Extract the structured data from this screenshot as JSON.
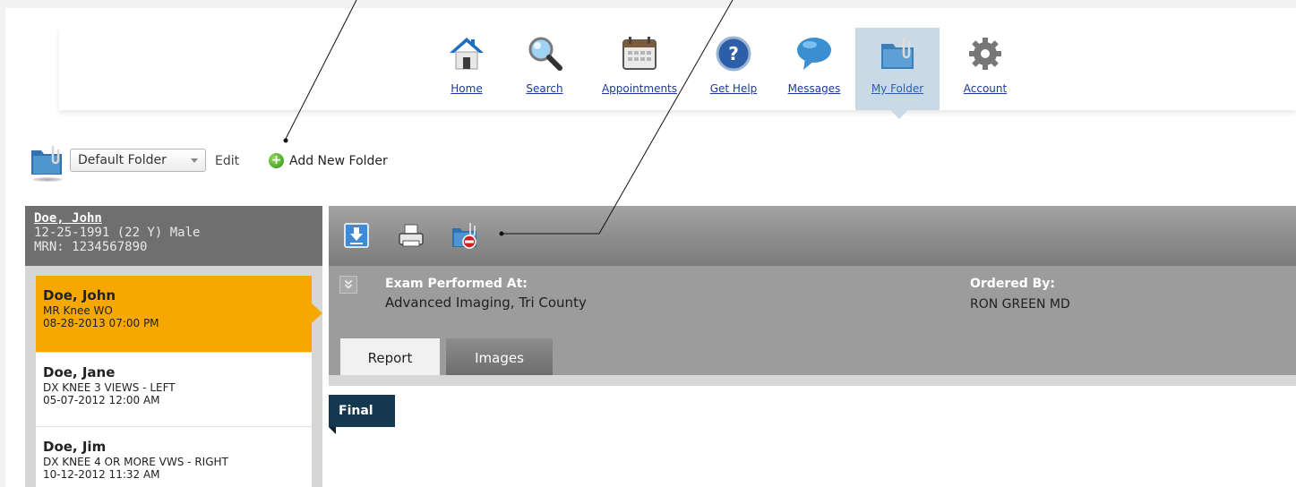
{
  "nav": {
    "items": [
      {
        "label": "Home",
        "icon": "home-icon"
      },
      {
        "label": "Search",
        "icon": "search-icon"
      },
      {
        "label": "Appointments",
        "icon": "calendar-icon"
      },
      {
        "label": "Get Help",
        "icon": "help-icon"
      },
      {
        "label": "Messages",
        "icon": "chat-bubble-icon"
      },
      {
        "label": "My Folder",
        "icon": "folder-clip-icon",
        "active": true
      },
      {
        "label": "Account",
        "icon": "gear-icon"
      }
    ]
  },
  "folder_bar": {
    "selected_folder": "Default Folder",
    "edit_label": "Edit",
    "add_folder_label": "Add New Folder"
  },
  "patient": {
    "name": "Doe, John",
    "dob_line": "12-25-1991 (22 Y) Male",
    "mrn_line": "MRN: 1234567890"
  },
  "exams": [
    {
      "name": "Doe, John",
      "study": "MR Knee WO",
      "datetime": "08-28-2013 07:00 PM",
      "selected": true
    },
    {
      "name": "Doe, Jane",
      "study": "DX KNEE 3 VIEWS - LEFT",
      "datetime": "05-07-2012 12:00 AM"
    },
    {
      "name": "Doe, Jim",
      "study": "DX KNEE 4 OR MORE VWS - RIGHT",
      "datetime": "10-12-2012 11:32 AM"
    }
  ],
  "exam_detail": {
    "performed_at_label": "Exam Performed At:",
    "performed_at_value": "Advanced Imaging, Tri County",
    "ordered_by_label": "Ordered By:",
    "ordered_by_value": "RON GREEN MD"
  },
  "tabs": {
    "report": "Report",
    "images": "Images"
  },
  "status": {
    "final": "Final"
  },
  "colors": {
    "selected_item": "#f6a800",
    "final_flag": "#14384f",
    "nav_active": "#c9d9e6"
  }
}
